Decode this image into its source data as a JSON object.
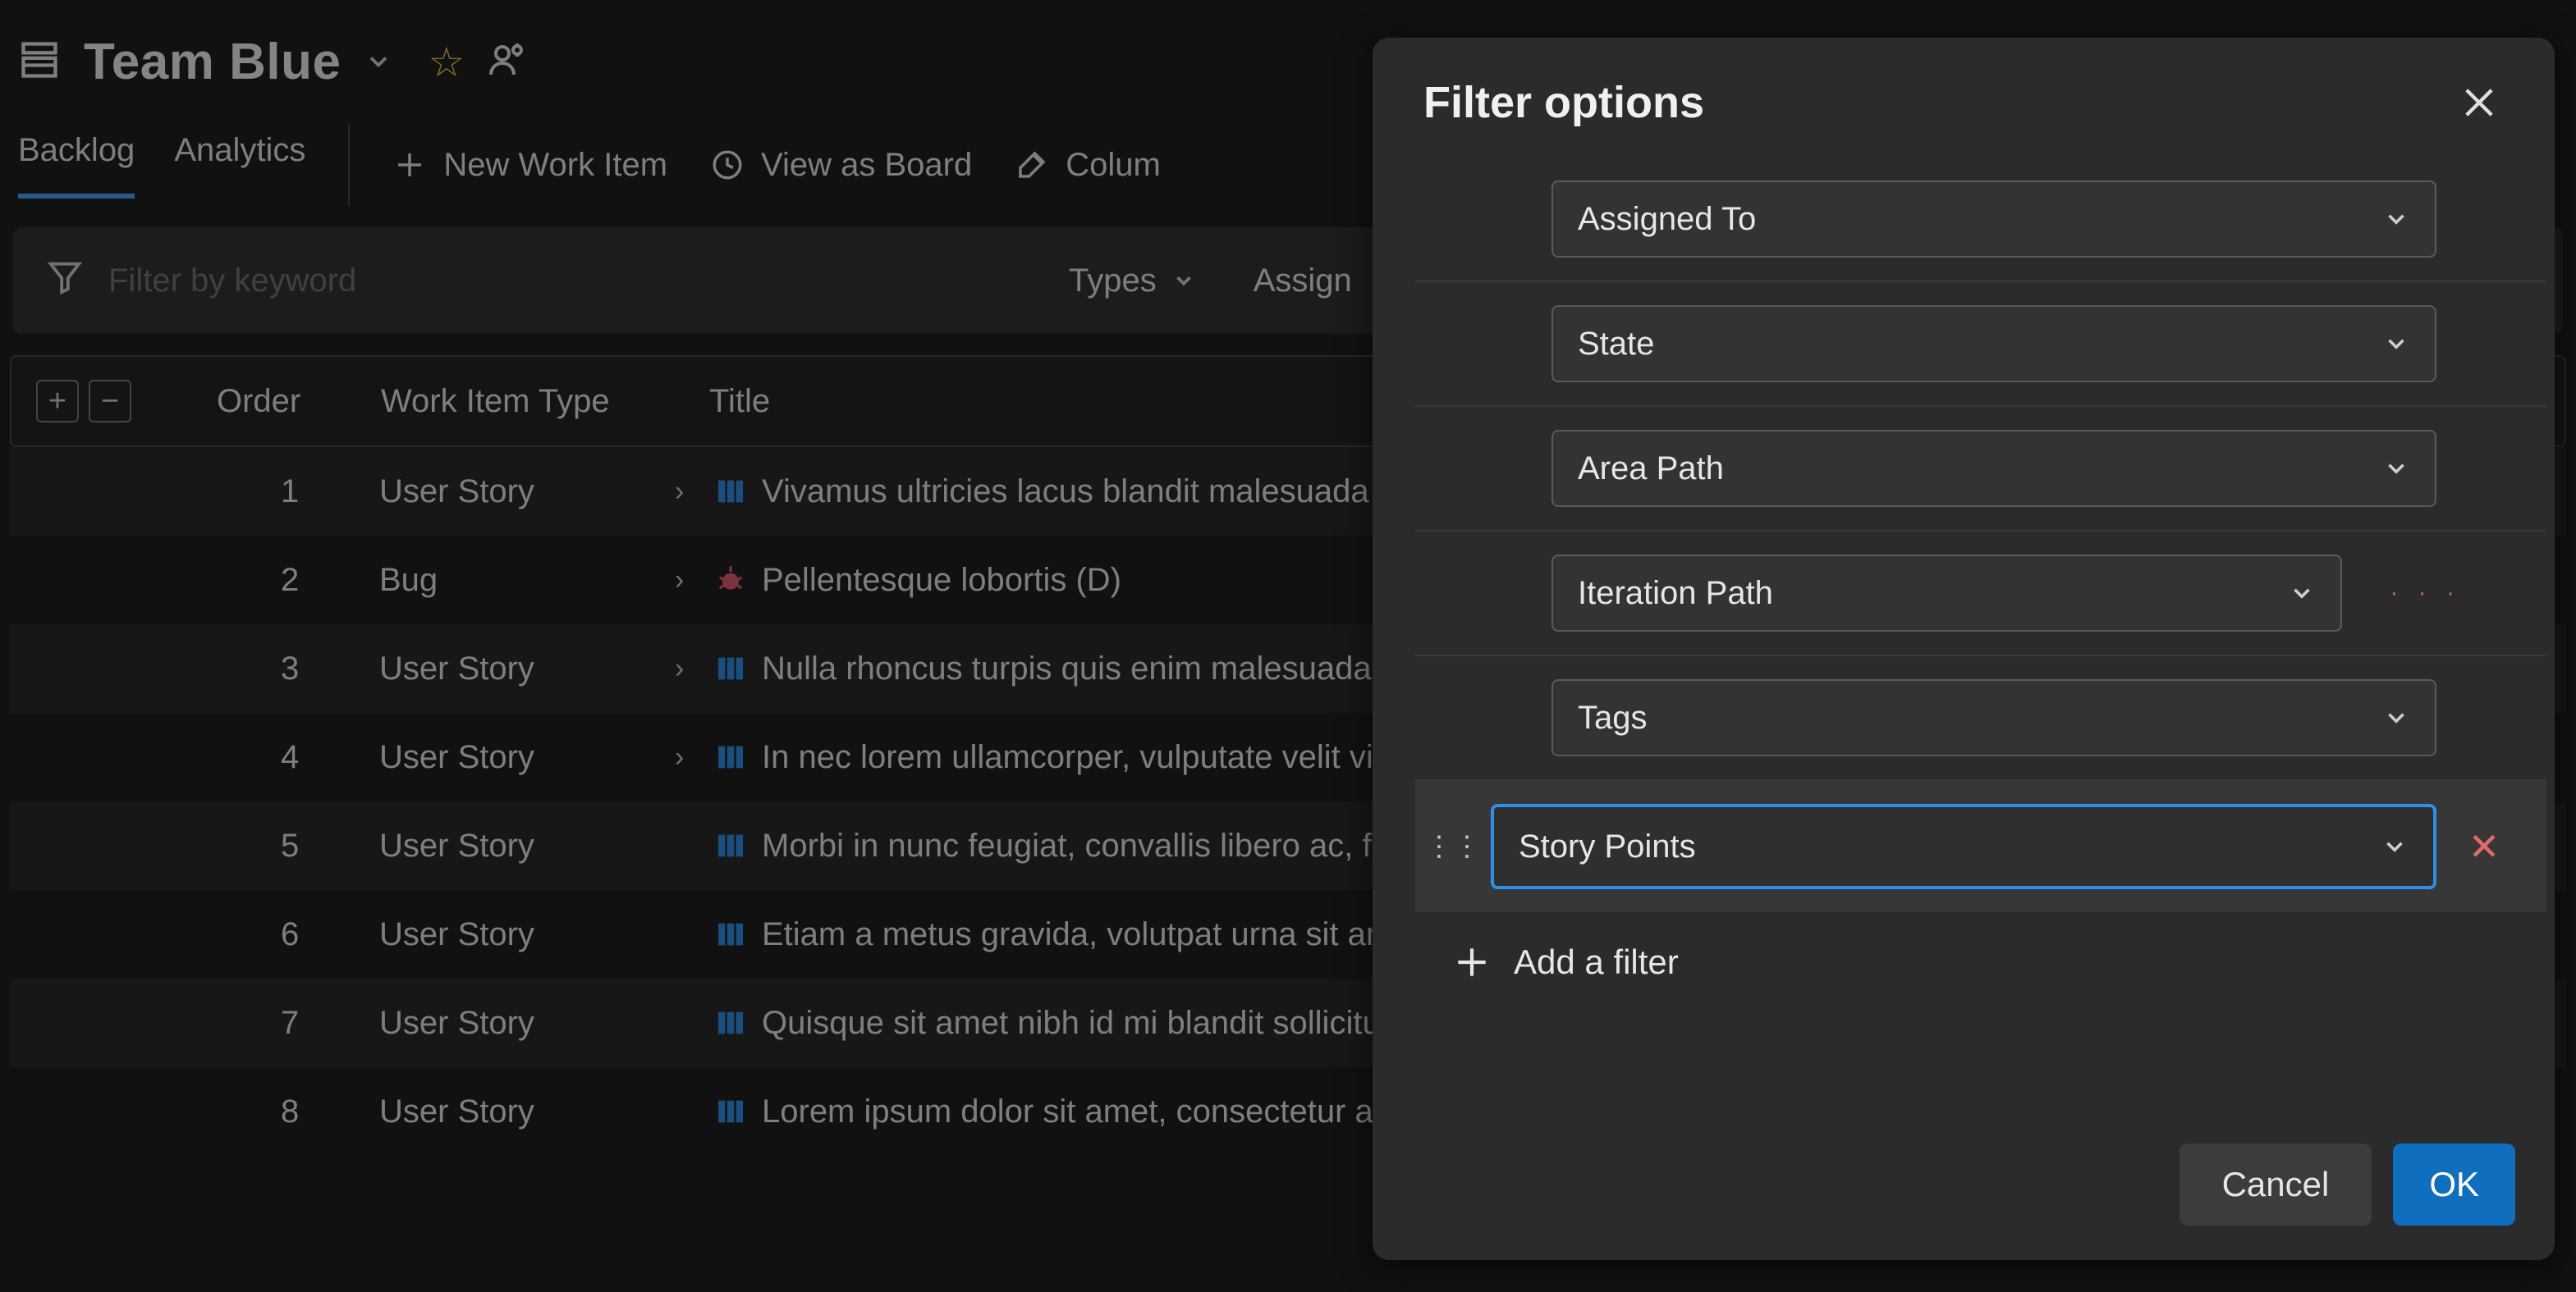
{
  "header": {
    "team_name": "Team Blue"
  },
  "tabs": {
    "backlog": "Backlog",
    "analytics": "Analytics"
  },
  "toolbar": {
    "new_work_item": "New Work Item",
    "view_as_board": "View as Board",
    "column_options": "Colum"
  },
  "filterbar": {
    "placeholder": "Filter by keyword",
    "types_chip": "Types",
    "assigned_chip": "Assign"
  },
  "columns": {
    "order": "Order",
    "work_item_type": "Work Item Type",
    "title": "Title"
  },
  "rows": [
    {
      "order": "1",
      "type": "User Story",
      "kind": "story",
      "expandable": true,
      "title": "Vivamus ultricies lacus blandit malesuada vulput"
    },
    {
      "order": "2",
      "type": "Bug",
      "kind": "bug",
      "expandable": true,
      "title": "Pellentesque lobortis (D)"
    },
    {
      "order": "3",
      "type": "User Story",
      "kind": "story",
      "expandable": true,
      "title": "Nulla rhoncus turpis quis enim malesuada, a vulp"
    },
    {
      "order": "4",
      "type": "User Story",
      "kind": "story",
      "expandable": true,
      "title": "In nec lorem ullamcorper, vulputate velit vitae, fe"
    },
    {
      "order": "5",
      "type": "User Story",
      "kind": "story",
      "expandable": false,
      "title": "Morbi in nunc feugiat, convallis libero ac, faucibu"
    },
    {
      "order": "6",
      "type": "User Story",
      "kind": "story",
      "expandable": false,
      "title": "Etiam a metus gravida, volutpat urna sit amet, rh"
    },
    {
      "order": "7",
      "type": "User Story",
      "kind": "story",
      "expandable": false,
      "title": "Quisque sit amet nibh id mi blandit sollicitudin tr"
    },
    {
      "order": "8",
      "type": "User Story",
      "kind": "story",
      "expandable": false,
      "title": "Lorem ipsum dolor sit amet, consectetur adipisci"
    }
  ],
  "panel": {
    "title": "Filter options",
    "filters": [
      {
        "label": "Assigned To",
        "selected": false
      },
      {
        "label": "State",
        "selected": false
      },
      {
        "label": "Area Path",
        "selected": false
      },
      {
        "label": "Iteration Path",
        "selected": false
      },
      {
        "label": "Tags",
        "selected": false
      },
      {
        "label": "Story Points",
        "selected": true
      }
    ],
    "add_filter": "Add a filter",
    "cancel": "Cancel",
    "ok": "OK"
  }
}
